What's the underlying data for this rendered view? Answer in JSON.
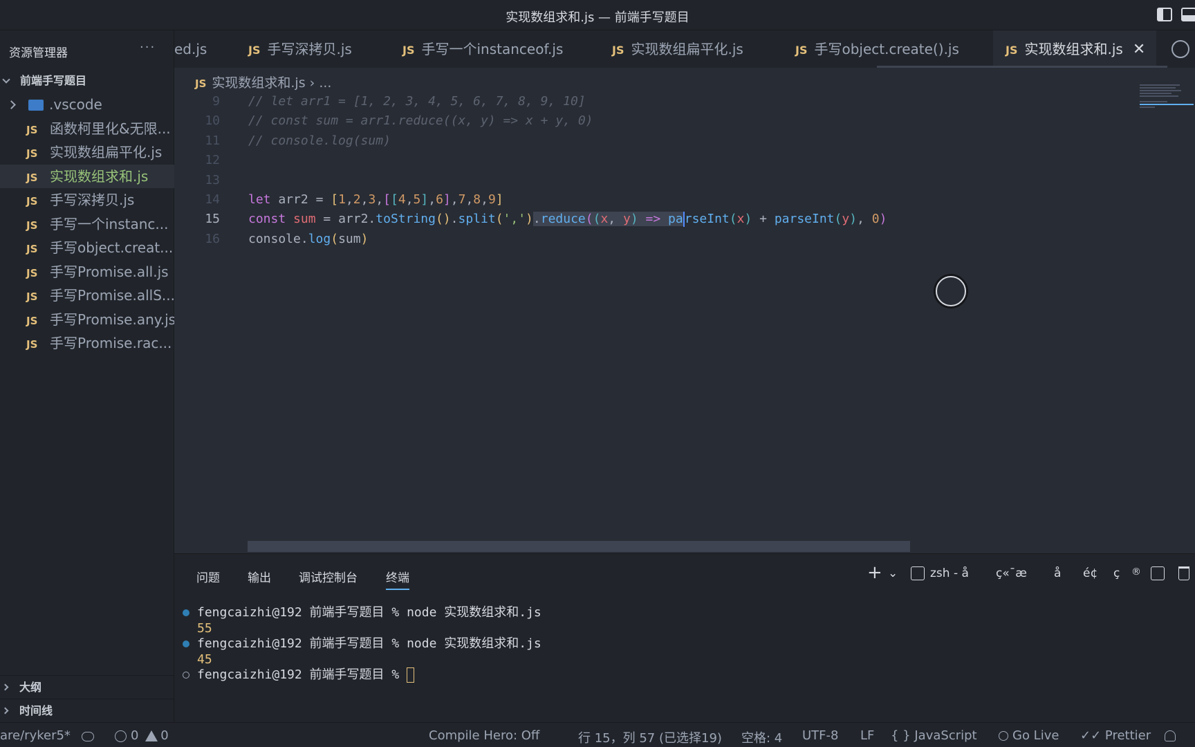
{
  "window": {
    "title": "实现数组求和.js — 前端手写题目"
  },
  "sidebar": {
    "header": "资源管理器",
    "more": "···",
    "folder": "前端手写题目",
    "folder_item": ".vscode",
    "files": [
      "函数柯里化&无限...",
      "实现数组扁平化.js",
      "实现数组求和.js",
      "手写深拷贝.js",
      "手写一个instanc...",
      "手写object.creat...",
      "手写Promise.all.js",
      "手写Promise.allS...",
      "手写Promise.any.js",
      "手写Promise.rac..."
    ],
    "outline": "大纲",
    "timeline": "时间线"
  },
  "js_badge": "JS",
  "tabs": [
    {
      "label": "ed.js"
    },
    {
      "label": "手写深拷贝.js"
    },
    {
      "label": "手写一个instanceof.js"
    },
    {
      "label": "实现数组扁平化.js"
    },
    {
      "label": "手写object.create().js"
    },
    {
      "label": "实现数组求和.js",
      "close": "✕"
    }
  ],
  "breadcrumb": {
    "file": "实现数组求和.js",
    "sep": "›",
    "rest": "..."
  },
  "editor": {
    "line_numbers": [
      "9",
      "10",
      "11",
      "12",
      "13",
      "14",
      "15",
      "16"
    ],
    "comments": [
      "// let arr1 = [1, 2, 3, 4, 5, 6, 7, 8, 9, 10]",
      "// const sum = arr1.reduce((x, y) => x + y, 0)",
      "// console.log(sum)"
    ]
  },
  "panel": {
    "tabs": [
      "问题",
      "输出",
      "调试控制台",
      "终端"
    ],
    "actions": {
      "add": "+",
      "add_chevron": "⌄",
      "shell": "zsh - å",
      "a1": "ç«¯æ",
      "a2": "å",
      "a3": "é¢",
      "a4": "ç",
      "a5": "®"
    },
    "terminal": [
      {
        "prompt": "fengcaizhi@192 前端手写题目 % node 实现数组求和.js",
        "output": "55"
      },
      {
        "prompt": "fengcaizhi@192 前端手写题目 % node 实现数组求和.js",
        "output": "45"
      },
      {
        "prompt": "fengcaizhi@192 前端手写题目 % "
      }
    ]
  },
  "statusbar": {
    "branch": "are/ryker5*",
    "errors": "0",
    "warnings": "0",
    "compile_hero": "Compile Hero: Off",
    "position": "行 15，列 57 (已选择19)",
    "spaces": "空格: 4",
    "encoding": "UTF-8",
    "eol": "LF",
    "braces": "{ }",
    "language": "JavaScript",
    "golive": "Go Live",
    "prettier": "Prettier"
  },
  "icons": [
    "split-editor-icon",
    "toggle-panel-icon",
    "chevron-right-icon",
    "close-icon",
    "trash-icon",
    "sync-icon",
    "error-icon",
    "warning-icon",
    "bell-icon"
  ],
  "colors": {
    "accent": "#61afef",
    "js_badge": "#e5c07b",
    "active_file": "#98c379"
  }
}
